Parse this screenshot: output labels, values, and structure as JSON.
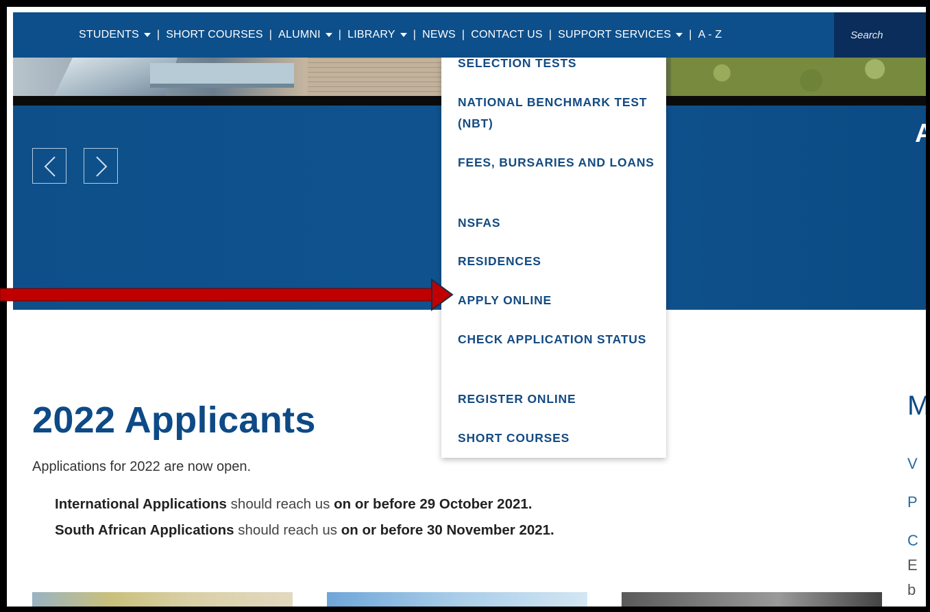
{
  "nav": {
    "items": [
      {
        "label": "STUDENTS",
        "dropdown": true
      },
      {
        "label": "SHORT COURSES",
        "dropdown": false
      },
      {
        "label": "ALUMNI",
        "dropdown": true
      },
      {
        "label": "LIBRARY",
        "dropdown": true
      },
      {
        "label": "NEWS",
        "dropdown": false
      },
      {
        "label": "CONTACT US",
        "dropdown": false
      },
      {
        "label": "SUPPORT SERVICES",
        "dropdown": true
      },
      {
        "label": "A - Z",
        "dropdown": false
      }
    ],
    "search_placeholder": "Search"
  },
  "dropdown": {
    "items": [
      "SELECTION TESTS",
      "NATIONAL BENCHMARK TEST (NBT)",
      "FEES, BURSARIES AND LOANS",
      "NSFAS",
      "RESIDENCES",
      "APPLY ONLINE",
      "CHECK APPLICATION STATUS",
      "REGISTER ONLINE",
      "SHORT COURSES"
    ]
  },
  "hero": {
    "cut_text": "A"
  },
  "content": {
    "title": "2022 Applicants",
    "intro": "Applications for 2022 are now open.",
    "intl_label": "International Applications",
    "intl_mid": "should reach us",
    "intl_deadline": "on or before 29 October 2021.",
    "sa_label": "South African Applications",
    "sa_mid": "should reach us",
    "sa_deadline": "on or before 30 November 2021."
  },
  "right_column_cut": [
    "M",
    "V",
    "P",
    "C",
    "E",
    "b"
  ],
  "colors": {
    "nav_bg": "#0d4f8b",
    "search_bg": "#0a2d5c",
    "hero_bg": "#0f538f",
    "title": "#0d4a86",
    "dropdown_text": "#134b83",
    "annotation_arrow": "#c00000"
  }
}
